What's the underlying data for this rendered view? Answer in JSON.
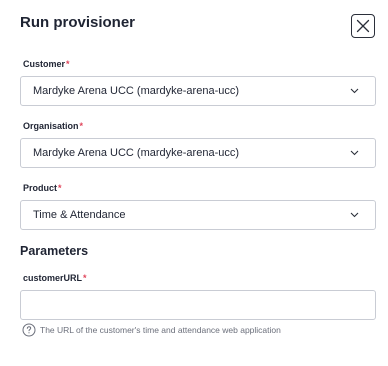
{
  "dialog": {
    "title": "Run provisioner",
    "close_icon": "close-icon"
  },
  "fields": {
    "customer": {
      "label": "Customer",
      "required_mark": "*",
      "value": "Mardyke Arena UCC (mardyke-arena-ucc)"
    },
    "organisation": {
      "label": "Organisation",
      "required_mark": "*",
      "value": "Mardyke Arena UCC (mardyke-arena-ucc)"
    },
    "product": {
      "label": "Product",
      "required_mark": "*",
      "value": "Time & Attendance"
    }
  },
  "parameters": {
    "title": "Parameters",
    "customer_url": {
      "label": "customerURL",
      "required_mark": "*",
      "value": "",
      "help_icon": "question-circle-icon",
      "help_text": "The URL of the customer's time and attendance web application"
    }
  },
  "colors": {
    "text": "#1f2433",
    "required": "#e0455b",
    "border": "#c9ccd4",
    "help_text": "#6b6f7b"
  }
}
